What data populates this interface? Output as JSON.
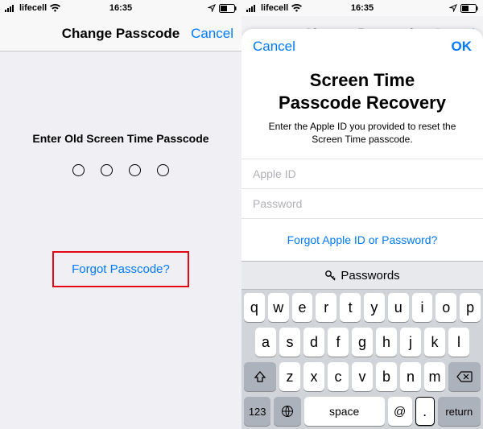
{
  "status": {
    "carrier": "lifecell",
    "time": "16:35"
  },
  "left": {
    "nav_title": "Change Passcode",
    "nav_cancel": "Cancel",
    "prompt": "Enter Old Screen Time Passcode",
    "forgot": "Forgot Passcode?"
  },
  "right": {
    "nav_title": "Change Passcode",
    "nav_cancel": "Cancel",
    "sheet_cancel": "Cancel",
    "sheet_ok": "OK",
    "sheet_title": "Screen Time\nPasscode Recovery",
    "sheet_sub": "Enter the Apple ID you provided to reset the Screen Time passcode.",
    "apple_id_placeholder": "Apple ID",
    "password_placeholder": "Password",
    "forgot_apple": "Forgot Apple ID or Password?"
  },
  "keyboard": {
    "accessory": "Passwords",
    "row1": [
      "q",
      "w",
      "e",
      "r",
      "t",
      "y",
      "u",
      "i",
      "o",
      "p"
    ],
    "row2": [
      "a",
      "s",
      "d",
      "f",
      "g",
      "h",
      "j",
      "k",
      "l"
    ],
    "row3": [
      "z",
      "x",
      "c",
      "v",
      "b",
      "n",
      "m"
    ],
    "space": "space",
    "return": "return",
    "numbers": "123",
    "at": "@",
    "period": "."
  }
}
